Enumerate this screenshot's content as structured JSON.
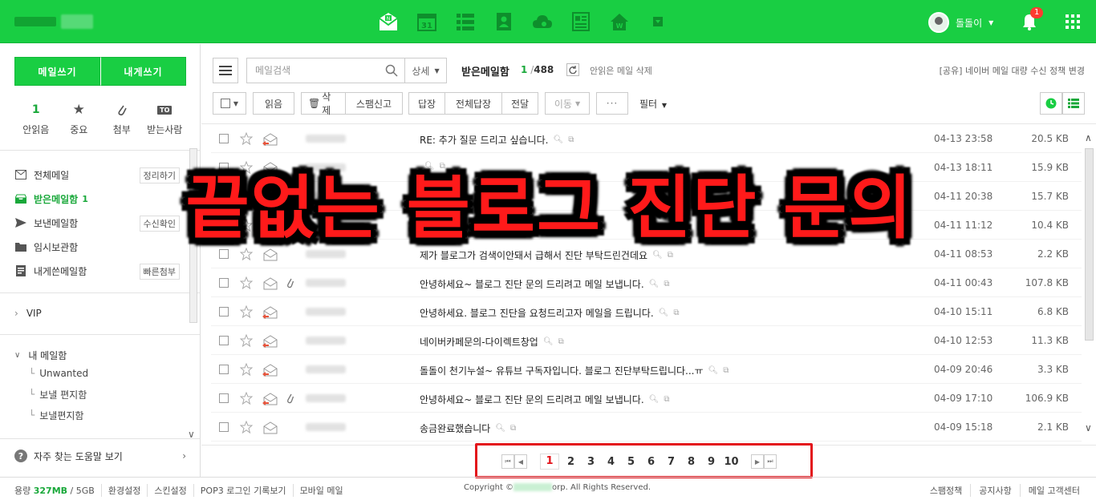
{
  "header": {
    "user_name": "돌돌이",
    "notification_count": "1"
  },
  "sidebar": {
    "write_mail": "메일쓰기",
    "write_self": "내게쓰기",
    "quick": [
      {
        "value": "1",
        "label": "안읽음"
      },
      {
        "value": "",
        "label": "중요"
      },
      {
        "value": "",
        "label": "첨부"
      },
      {
        "value": "TO",
        "label": "받는사람"
      }
    ],
    "folders": [
      {
        "name": "전체메일",
        "action": "정리하기"
      },
      {
        "name": "받은메일함",
        "count": "1"
      },
      {
        "name": "보낸메일함",
        "action": "수신확인"
      },
      {
        "name": "임시보관함"
      },
      {
        "name": "내게쓴메일함",
        "action": "빠른첨부"
      }
    ],
    "vip": "VIP",
    "my_mailbox": "내 메일함",
    "subfolders": [
      "Unwanted",
      "보낼 편지함",
      "보낼편지함"
    ],
    "help": "자주 찾는 도움말 보기"
  },
  "toolbar": {
    "search_placeholder": "메일검색",
    "detail": "상세",
    "box_title": "받은메일함",
    "unread": "1",
    "total": "488",
    "delete_unread": "안읽은 메일 삭제",
    "notice": "[공유] 네이버 메일 대량 수신 정책 변경",
    "read": "읽음",
    "delete": "삭제",
    "spam": "스팸신고",
    "reply": "답장",
    "reply_all": "전체답장",
    "forward": "전달",
    "move": "이동",
    "more": "···",
    "filter": "필터"
  },
  "mails": [
    {
      "subject": "RE: 추가 질문 드리고 싶습니다.",
      "date": "04-13 23:58",
      "size": "20.5 KB",
      "reply": true,
      "attach": false
    },
    {
      "subject": "",
      "date": "04-13 18:11",
      "size": "15.9 KB",
      "reply": true,
      "attach": false
    },
    {
      "subject": "",
      "date": "04-11 20:38",
      "size": "15.7 KB",
      "reply": true,
      "attach": false
    },
    {
      "subject": "",
      "date": "04-11 11:12",
      "size": "10.4 KB",
      "reply": true,
      "attach": false
    },
    {
      "subject": "제가 블로그가 검색이안돼서 급해서 진단 부탁드린건데요",
      "date": "04-11 08:53",
      "size": "2.2 KB",
      "reply": false,
      "attach": false
    },
    {
      "subject": "안녕하세요~ 블로그 진단 문의 드리려고 메일 보냅니다.",
      "date": "04-11 00:43",
      "size": "107.8 KB",
      "reply": false,
      "attach": true
    },
    {
      "subject": "안녕하세요. 블로그 진단을 요청드리고자 메일을 드립니다.",
      "date": "04-10 15:11",
      "size": "6.8 KB",
      "reply": true,
      "attach": false
    },
    {
      "subject": "네이버카페문의-다이렉트창업",
      "date": "04-10 12:53",
      "size": "11.3 KB",
      "reply": true,
      "attach": false
    },
    {
      "subject": "돌돌이 천기누설~ 유튜브 구독자입니다. 블로그 진단부탁드립니다...ㅠ",
      "date": "04-09 20:46",
      "size": "3.3 KB",
      "reply": true,
      "attach": false
    },
    {
      "subject": "안녕하세요~ 블로그 진단 문의 드리려고 메일 보냅니다.",
      "date": "04-09 17:10",
      "size": "106.9 KB",
      "reply": true,
      "attach": true
    },
    {
      "subject": "송금완료했습니다",
      "date": "04-09 15:18",
      "size": "2.1 KB",
      "reply": false,
      "attach": false
    }
  ],
  "pagination": {
    "pages": [
      "1",
      "2",
      "3",
      "4",
      "5",
      "6",
      "7",
      "8",
      "9",
      "10"
    ],
    "current": "1"
  },
  "overlay": {
    "headline": "끝없는 블로그 진단 문의"
  },
  "footer": {
    "quota_label": "용량",
    "quota_used": "327MB",
    "quota_total": "/ 5GB",
    "links_left": [
      "환경설정",
      "스킨설정",
      "POP3 로그인 기록보기",
      "모바일 메일"
    ],
    "copyright_pre": "Copyright ©",
    "copyright_post": "orp. All Rights Reserved.",
    "links_right": [
      "스팸정책",
      "공지사항",
      "메일 고객센터"
    ]
  },
  "colors": {
    "brand_green": "#19ce43",
    "accent_red": "#e3141b"
  }
}
